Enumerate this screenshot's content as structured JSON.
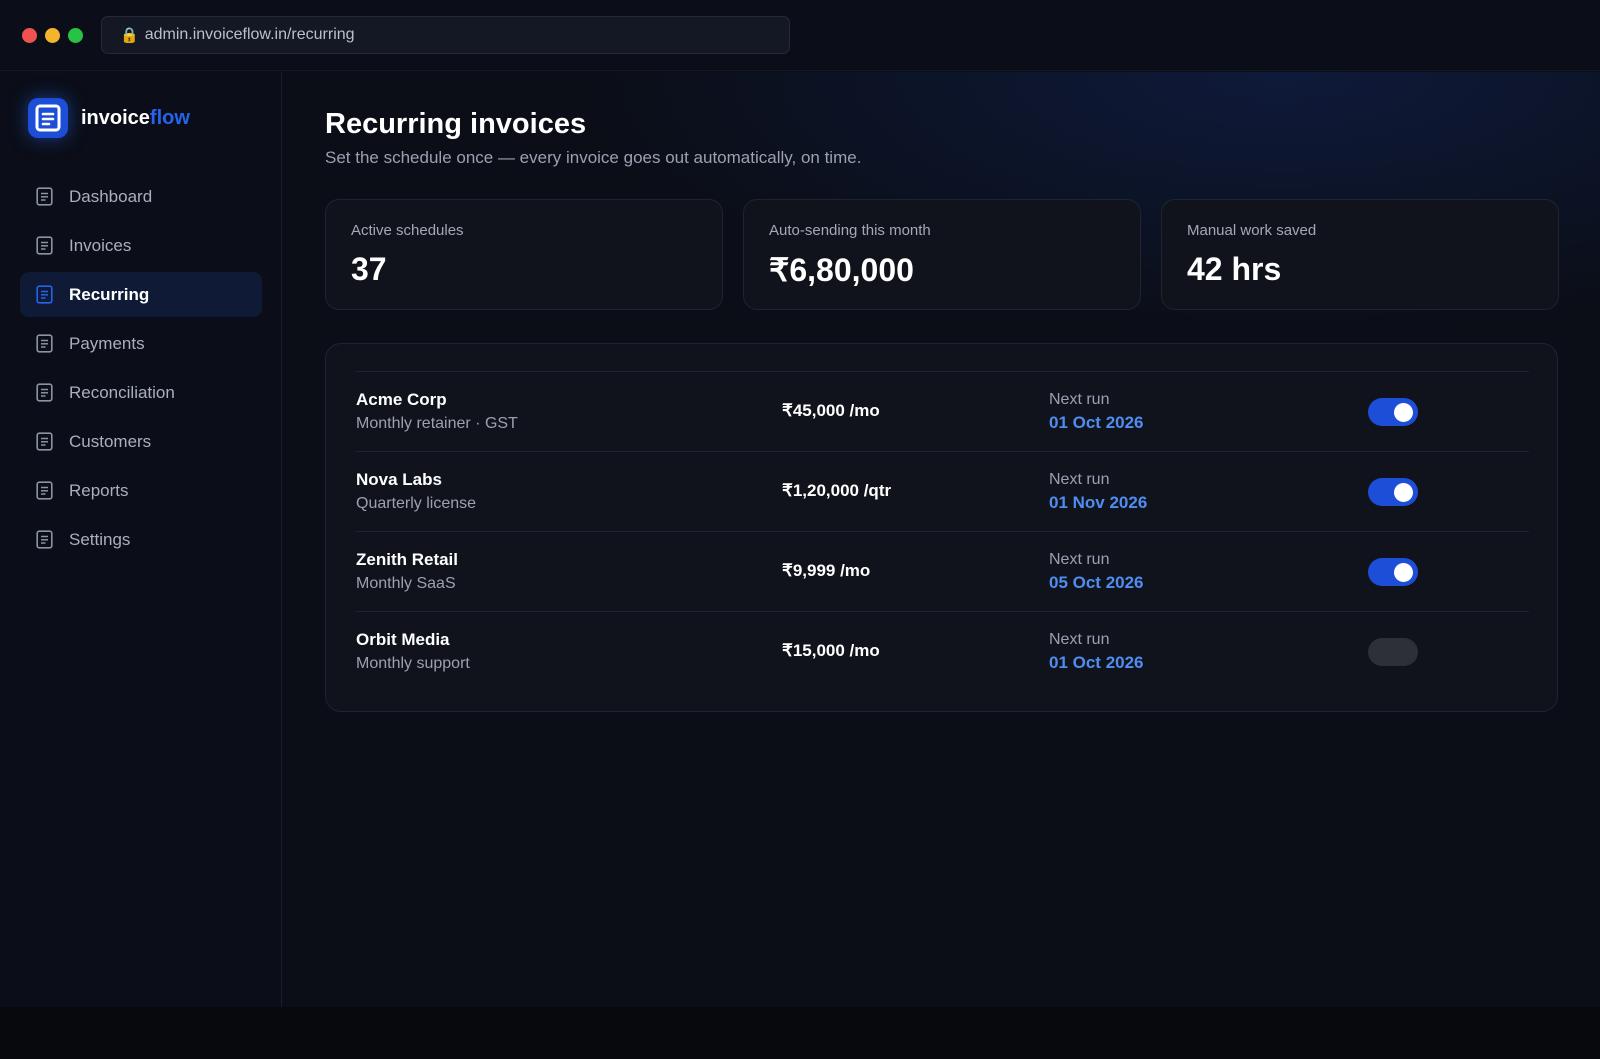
{
  "browser": {
    "url": "admin.invoiceflow.in/recurring",
    "lock_icon": "🔒"
  },
  "brand": {
    "name_main": "invoice",
    "name_accent": "flow",
    "accent_color": "#2563eb"
  },
  "sidebar": {
    "items": [
      {
        "label": "Dashboard",
        "icon": "document-icon",
        "active": false
      },
      {
        "label": "Invoices",
        "icon": "document-icon",
        "active": false
      },
      {
        "label": "Recurring",
        "icon": "document-icon",
        "active": true
      },
      {
        "label": "Payments",
        "icon": "document-icon",
        "active": false
      },
      {
        "label": "Reconciliation",
        "icon": "document-icon",
        "active": false
      },
      {
        "label": "Customers",
        "icon": "document-icon",
        "active": false
      },
      {
        "label": "Reports",
        "icon": "document-icon",
        "active": false
      },
      {
        "label": "Settings",
        "icon": "document-icon",
        "active": false
      }
    ]
  },
  "page": {
    "title": "Recurring invoices",
    "subtitle": "Set the schedule once — every invoice goes out automatically, on time."
  },
  "stats": [
    {
      "label": "Active schedules",
      "value": "37"
    },
    {
      "label": "Auto-sending this month",
      "value": "₹6,80,000"
    },
    {
      "label": "Manual work saved",
      "value": "42 hrs"
    }
  ],
  "schedules": [
    {
      "client": "Acme Corp",
      "description": "Monthly retainer · GST",
      "amount": "₹45,000 /mo",
      "next_run_label": "Next run",
      "next_run_date": "01 Oct 2026",
      "enabled": true
    },
    {
      "client": "Nova Labs",
      "description": "Quarterly license",
      "amount": "₹1,20,000 /qtr",
      "next_run_label": "Next run",
      "next_run_date": "01 Nov 2026",
      "enabled": true
    },
    {
      "client": "Zenith Retail",
      "description": "Monthly SaaS",
      "amount": "₹9,999 /mo",
      "next_run_label": "Next run",
      "next_run_date": "05 Oct 2026",
      "enabled": true
    },
    {
      "client": "Orbit Media",
      "description": "Monthly support",
      "amount": "₹15,000 /mo",
      "next_run_label": "Next run",
      "next_run_date": "01 Oct 2026",
      "enabled": false
    }
  ],
  "colors": {
    "toggle_on": "#1d4ed8",
    "toggle_off": "#2e3038",
    "date_accent": "#4f8df0"
  }
}
